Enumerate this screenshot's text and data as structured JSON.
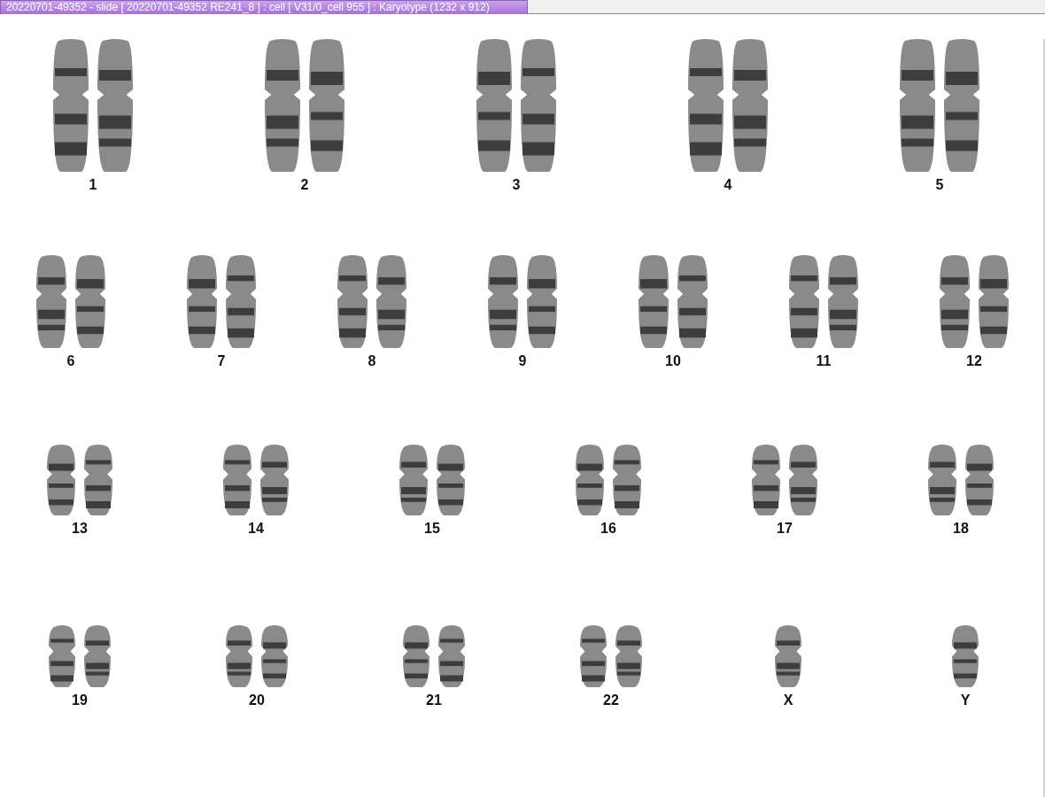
{
  "window": {
    "title": "20220701-49352 - slide [ 20220701-49352 RE241_8 ] : cell [ V31/0_cell 955 ] : Karyotype  (1232 x 912)"
  },
  "karyotype": {
    "rows": [
      {
        "items": [
          {
            "label": "1",
            "kind": "pair"
          },
          {
            "label": "2",
            "kind": "pair"
          },
          {
            "label": "3",
            "kind": "pair"
          },
          {
            "label": "4",
            "kind": "pair"
          },
          {
            "label": "5",
            "kind": "pair"
          }
        ]
      },
      {
        "items": [
          {
            "label": "6",
            "kind": "pair"
          },
          {
            "label": "7",
            "kind": "pair"
          },
          {
            "label": "8",
            "kind": "pair"
          },
          {
            "label": "9",
            "kind": "pair"
          },
          {
            "label": "10",
            "kind": "pair"
          },
          {
            "label": "11",
            "kind": "pair"
          },
          {
            "label": "12",
            "kind": "pair"
          }
        ]
      },
      {
        "items": [
          {
            "label": "13",
            "kind": "pair"
          },
          {
            "label": "14",
            "kind": "pair"
          },
          {
            "label": "15",
            "kind": "pair"
          },
          {
            "label": "16",
            "kind": "pair"
          },
          {
            "label": "17",
            "kind": "pair"
          },
          {
            "label": "18",
            "kind": "pair"
          }
        ]
      },
      {
        "items": [
          {
            "label": "19",
            "kind": "pair"
          },
          {
            "label": "20",
            "kind": "pair"
          },
          {
            "label": "21",
            "kind": "pair"
          },
          {
            "label": "22",
            "kind": "pair"
          },
          {
            "label": "X",
            "kind": "single"
          },
          {
            "label": "Y",
            "kind": "single"
          }
        ]
      }
    ]
  }
}
